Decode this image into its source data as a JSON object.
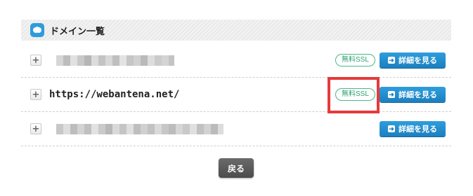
{
  "section": {
    "title": "ドメイン一覧",
    "icon": "domain-list-icon"
  },
  "domains": [
    {
      "name": "",
      "ssl_label": "無料SSL",
      "detail_label": "詳細を見る"
    },
    {
      "name": "https://webantena.net/",
      "ssl_label": "無料SSL",
      "detail_label": "詳細を見る"
    },
    {
      "name": "",
      "detail_label": "詳細を見る"
    }
  ],
  "expand_label": "+",
  "detail_arrow": "➜",
  "back_label": "戻る",
  "colors": {
    "accent": "#1c7fbe",
    "ssl": "#48b889",
    "highlight": "#e53a3a",
    "back_button": "#555555"
  }
}
